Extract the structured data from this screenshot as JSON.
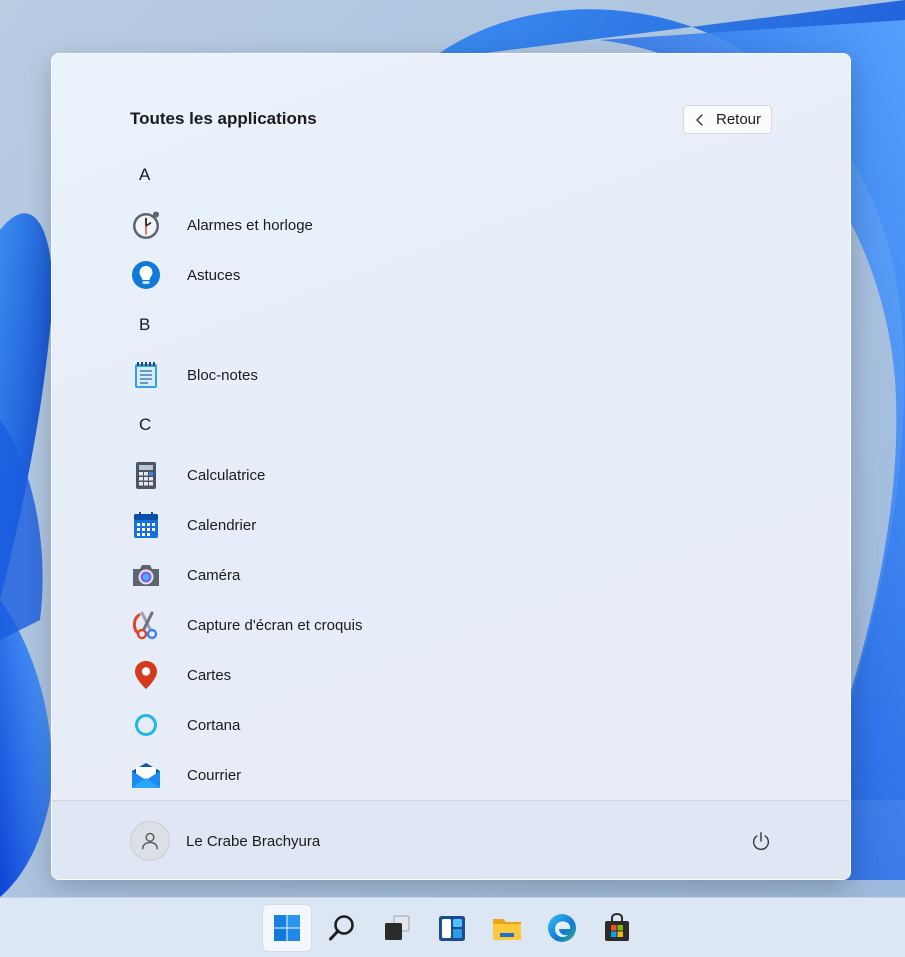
{
  "start_menu": {
    "title": "Toutes les applications",
    "back_label": "Retour",
    "sections": [
      {
        "letter": "A",
        "apps": [
          {
            "name": "Alarmes et horloge",
            "icon": "alarm-clock-icon"
          },
          {
            "name": "Astuces",
            "icon": "tips-lightbulb-icon"
          }
        ]
      },
      {
        "letter": "B",
        "apps": [
          {
            "name": "Bloc-notes",
            "icon": "notepad-icon"
          }
        ]
      },
      {
        "letter": "C",
        "apps": [
          {
            "name": "Calculatrice",
            "icon": "calculator-icon"
          },
          {
            "name": "Calendrier",
            "icon": "calendar-icon"
          },
          {
            "name": "Caméra",
            "icon": "camera-icon"
          },
          {
            "name": "Capture d'écran et croquis",
            "icon": "snip-sketch-icon"
          },
          {
            "name": "Cartes",
            "icon": "maps-pin-icon"
          },
          {
            "name": "Cortana",
            "icon": "cortana-icon"
          },
          {
            "name": "Courrier",
            "icon": "mail-icon"
          }
        ]
      }
    ],
    "footer": {
      "user_name": "Le Crabe Brachyura",
      "user_icon": "user-avatar-icon",
      "power_icon": "power-icon"
    }
  },
  "taskbar": {
    "items": [
      {
        "name": "start",
        "icon": "windows-start-icon",
        "active": true
      },
      {
        "name": "search",
        "icon": "search-icon",
        "active": false
      },
      {
        "name": "task-view",
        "icon": "task-view-icon",
        "active": false
      },
      {
        "name": "widgets",
        "icon": "widgets-icon",
        "active": false
      },
      {
        "name": "file-explorer",
        "icon": "folder-icon",
        "active": false
      },
      {
        "name": "edge",
        "icon": "edge-browser-icon",
        "active": false
      },
      {
        "name": "store",
        "icon": "store-bag-icon",
        "active": false
      }
    ]
  },
  "colors": {
    "accent": "#0078d4",
    "menu_background": "#e8eff9",
    "taskbar_background": "#dde6f3"
  }
}
